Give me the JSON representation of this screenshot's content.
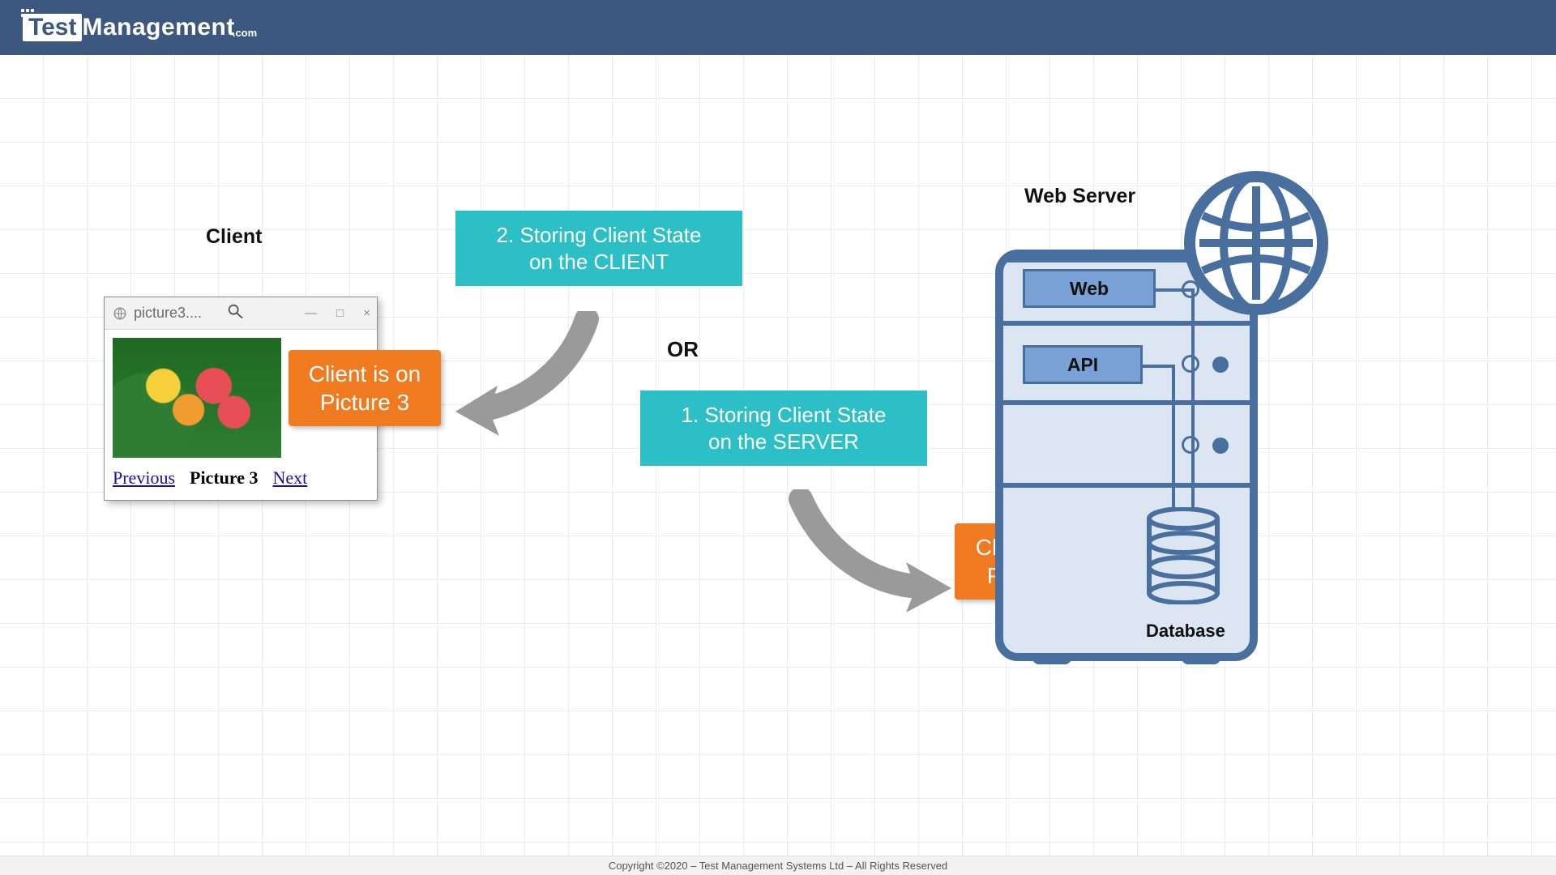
{
  "brand": {
    "test": "Test",
    "mgmt": "Management",
    "com": ".com"
  },
  "labels": {
    "client": "Client",
    "web_server": "Web Server",
    "or": "OR",
    "database": "Database"
  },
  "teal": {
    "client_state": "2. Storing Client State\non the CLIENT",
    "server_state": "1. Storing Client State\non the SERVER"
  },
  "orange": {
    "client_pic": "Client is on\nPicture 3",
    "server_pic": "Client is on\nPicture 3"
  },
  "browser": {
    "tab_title": "picture3....",
    "nav_prev": "Previous",
    "nav_current": "Picture 3",
    "nav_next": "Next",
    "win_min": "—",
    "win_max": "□",
    "win_close": "×"
  },
  "server": {
    "web": "Web",
    "api": "API"
  },
  "footer": "Copyright ©2020 – Test Management Systems Ltd – All Rights Reserved"
}
